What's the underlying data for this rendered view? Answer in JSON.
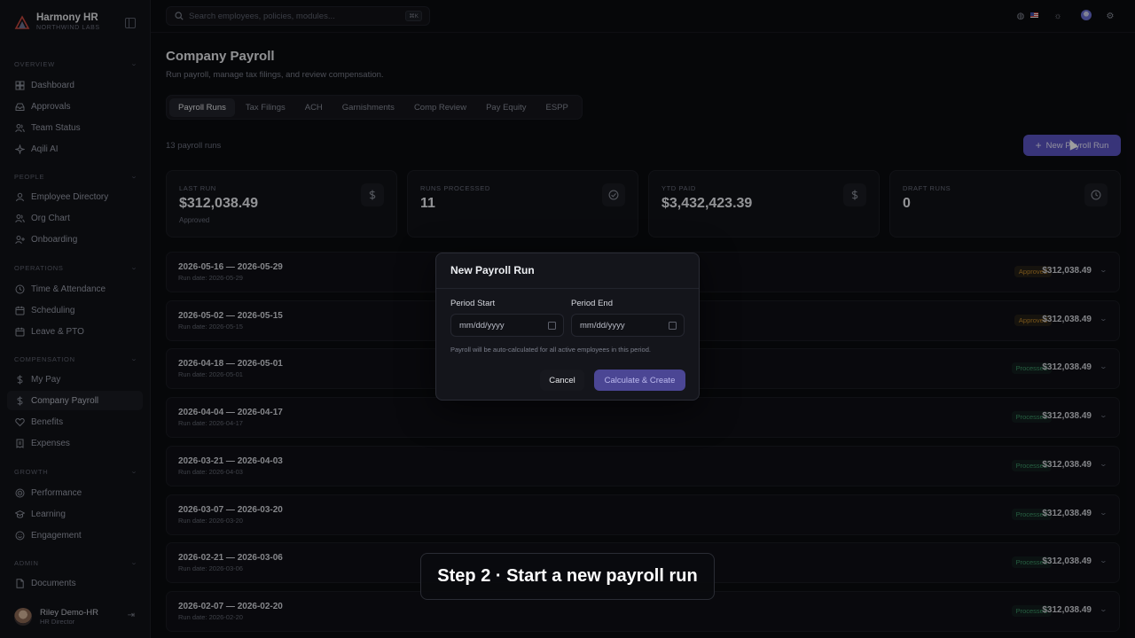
{
  "brand": {
    "name": "Harmony HR",
    "org": "NORTHWIND LABS"
  },
  "sidebar": {
    "sections": [
      {
        "label": "OVERVIEW",
        "items": [
          {
            "label": "Dashboard",
            "icon": "grid-icon"
          },
          {
            "label": "Approvals",
            "icon": "inbox-icon"
          },
          {
            "label": "Team Status",
            "icon": "users-icon"
          },
          {
            "label": "Aqili AI",
            "icon": "sparkle-icon"
          }
        ]
      },
      {
        "label": "PEOPLE",
        "items": [
          {
            "label": "Employee Directory",
            "icon": "user-icon"
          },
          {
            "label": "Org Chart",
            "icon": "users-icon"
          },
          {
            "label": "Onboarding",
            "icon": "user-plus-icon"
          }
        ]
      },
      {
        "label": "OPERATIONS",
        "items": [
          {
            "label": "Time & Attendance",
            "icon": "clock-icon"
          },
          {
            "label": "Scheduling",
            "icon": "calendar-icon"
          },
          {
            "label": "Leave & PTO",
            "icon": "calendar-icon"
          }
        ]
      },
      {
        "label": "COMPENSATION",
        "items": [
          {
            "label": "My Pay",
            "icon": "dollar-icon"
          },
          {
            "label": "Company Payroll",
            "icon": "dollar-icon",
            "active": true
          },
          {
            "label": "Benefits",
            "icon": "heart-icon"
          },
          {
            "label": "Expenses",
            "icon": "receipt-icon"
          }
        ]
      },
      {
        "label": "GROWTH",
        "items": [
          {
            "label": "Performance",
            "icon": "target-icon"
          },
          {
            "label": "Learning",
            "icon": "graduation-cap-icon"
          },
          {
            "label": "Engagement",
            "icon": "smile-icon"
          }
        ]
      },
      {
        "label": "ADMIN",
        "items": [
          {
            "label": "Documents",
            "icon": "file-icon"
          }
        ]
      }
    ],
    "user": {
      "name": "Riley Demo-HR",
      "role": "HR Director"
    }
  },
  "topbar": {
    "search_placeholder": "Search employees, policies, modules...",
    "search_shortcut": "⌘K"
  },
  "page": {
    "title": "Company Payroll",
    "subtitle": "Run payroll, manage tax filings, and review compensation.",
    "tabs": [
      "Payroll Runs",
      "Tax Filings",
      "ACH",
      "Garnishments",
      "Comp Review",
      "Pay Equity",
      "ESPP"
    ],
    "active_tab": "Payroll Runs",
    "runs_count": "13 payroll runs",
    "new_run_label": "New Payroll Run"
  },
  "stats": [
    {
      "label": "LAST RUN",
      "value": "$312,038.49",
      "note": "Approved",
      "icon": "dollar-icon"
    },
    {
      "label": "RUNS PROCESSED",
      "value": "11",
      "note": "",
      "icon": "check-circle-icon"
    },
    {
      "label": "YTD PAID",
      "value": "$3,432,423.39",
      "note": "",
      "icon": "dollar-icon"
    },
    {
      "label": "DRAFT RUNS",
      "value": "0",
      "note": "",
      "icon": "clock-icon"
    }
  ],
  "runs": [
    {
      "period": "2026-05-16 — 2026-05-29",
      "run_date": "Run date: 2026-05-29",
      "status": "Approved",
      "amount": "$312,038.49"
    },
    {
      "period": "2026-05-02 — 2026-05-15",
      "run_date": "Run date: 2026-05-15",
      "status": "Approved",
      "amount": "$312,038.49"
    },
    {
      "period": "2026-04-18 — 2026-05-01",
      "run_date": "Run date: 2026-05-01",
      "status": "Processed",
      "amount": "$312,038.49"
    },
    {
      "period": "2026-04-04 — 2026-04-17",
      "run_date": "Run date: 2026-04-17",
      "status": "Processed",
      "amount": "$312,038.49"
    },
    {
      "period": "2026-03-21 — 2026-04-03",
      "run_date": "Run date: 2026-04-03",
      "status": "Processed",
      "amount": "$312,038.49"
    },
    {
      "period": "2026-03-07 — 2026-03-20",
      "run_date": "Run date: 2026-03-20",
      "status": "Processed",
      "amount": "$312,038.49"
    },
    {
      "period": "2026-02-21 — 2026-03-06",
      "run_date": "Run date: 2026-03-06",
      "status": "Processed",
      "amount": "$312,038.49"
    },
    {
      "period": "2026-02-07 — 2026-02-20",
      "run_date": "Run date: 2026-02-20",
      "status": "Processed",
      "amount": "$312,038.49"
    }
  ],
  "modal": {
    "title": "New Payroll Run",
    "period_start_label": "Period Start",
    "period_end_label": "Period End",
    "date_placeholder": "mm/dd/yyyy",
    "note": "Payroll will be auto-calculated for all active employees in this period.",
    "cancel_label": "Cancel",
    "create_label": "Calculate & Create"
  },
  "caption": "Step 2 · Start a new payroll run",
  "colors": {
    "accent": "#5b54c4",
    "approved": "#c38a2b",
    "processed": "#3e9b6a",
    "background": "#0b0c10"
  }
}
